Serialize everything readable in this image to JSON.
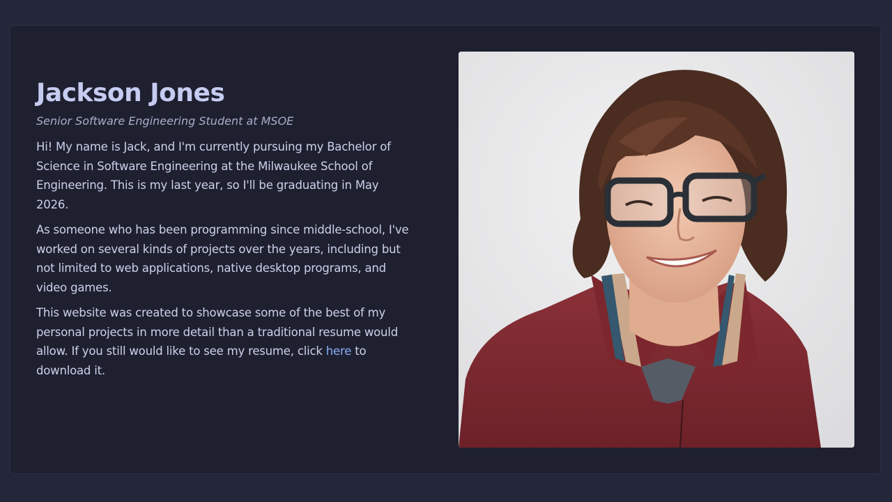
{
  "profile": {
    "name": "Jackson Jones",
    "subtitle": "Senior Software Engineering Student at MSOE",
    "paragraphs": [
      "Hi! My name is Jack, and I'm currently pursuing my Bachelor of Science in Software Engineering at the Milwaukee School of Engineering. This is my last year, so I'll be graduating in May 2026.",
      "As someone who has been programming since middle-school, I've worked on several kinds of projects over the years, including but not limited to web applications, native desktop programs, and video games."
    ],
    "resume_paragraph": {
      "before_link": "This website was created to showcase some of the best of my personal projects in more detail than a traditional resume would allow. If you still would like to see my resume, click ",
      "link_text": "here",
      "after_link": " to download it."
    }
  },
  "colors": {
    "page_background": "#24273a",
    "card_background": "#1e2030",
    "name": "#c6cbf0",
    "body_text": "#cdd1ea",
    "link": "#8aadf4",
    "sweater": "#7a2a30"
  },
  "photo": {
    "subject": "portrait-photo"
  }
}
